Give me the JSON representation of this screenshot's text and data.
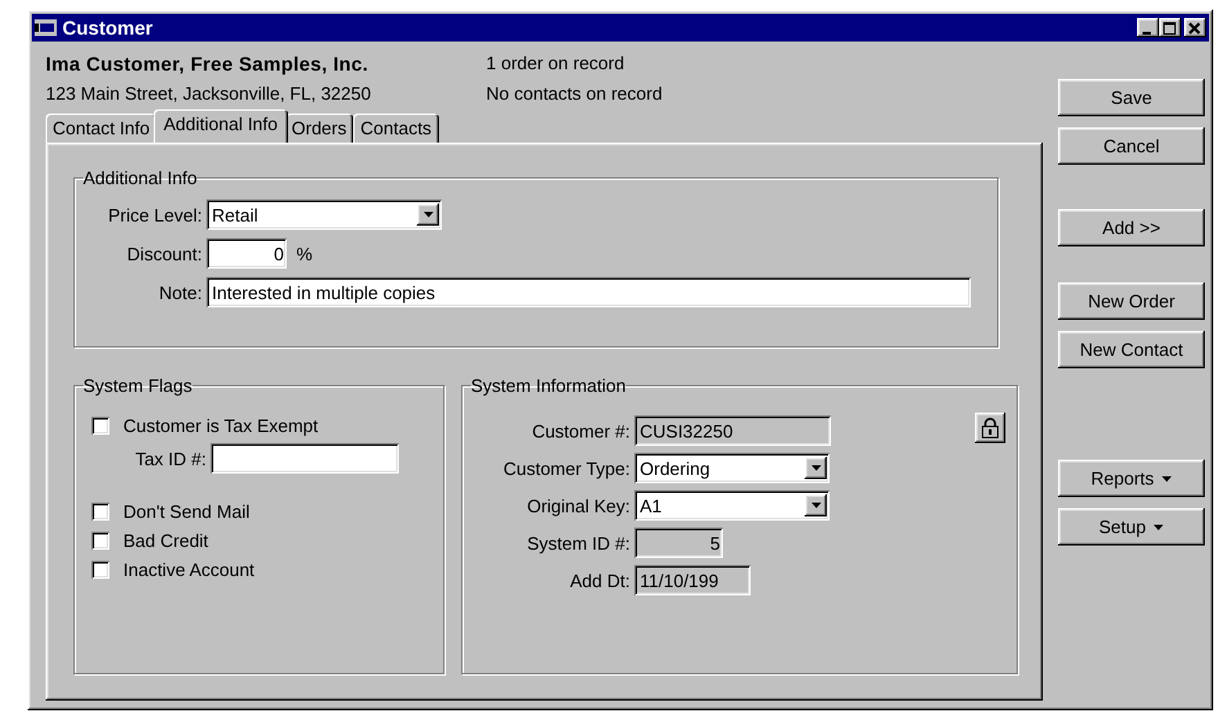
{
  "window": {
    "title": "Customer"
  },
  "header": {
    "name": "Ima Customer, Free Samples, Inc.",
    "address": "123 Main Street, Jacksonville, FL, 32250",
    "orders_summary": "1 order on record",
    "contacts_summary": "No contacts on record"
  },
  "tabs": [
    {
      "label": "Contact Info",
      "selected": false
    },
    {
      "label": "Additional Info",
      "selected": true
    },
    {
      "label": "Orders",
      "selected": false
    },
    {
      "label": "Contacts",
      "selected": false
    }
  ],
  "additional_info": {
    "title": "Additional Info",
    "fields": [
      {
        "kind": "dropdown",
        "label": "Price Level:",
        "value": "Retail"
      },
      {
        "kind": "number",
        "label": "Discount:",
        "value": "0",
        "suffix": "%"
      },
      {
        "kind": "text",
        "label": "Note:",
        "value": "Interested in multiple copies"
      }
    ]
  },
  "system_flags": {
    "title": "System Flags",
    "items": [
      {
        "kind": "checkbox",
        "label": "Customer is Tax Exempt",
        "checked": false
      },
      {
        "kind": "text",
        "label": "Tax ID #:"
      },
      {
        "kind": "checkbox",
        "label": "Don't Send Mail",
        "checked": false
      },
      {
        "kind": "checkbox",
        "label": "Bad Credit",
        "checked": false
      },
      {
        "kind": "checkbox",
        "label": "Inactive Account",
        "checked": false
      }
    ]
  },
  "system_information": {
    "title": "System Information",
    "fields": [
      {
        "kind": "readonly",
        "label": "Customer #:",
        "value": "CUSI32250"
      },
      {
        "kind": "dropdown",
        "label": "Customer Type:",
        "value": "Ordering"
      },
      {
        "kind": "dropdown",
        "label": "Original Key:",
        "value": "A1"
      },
      {
        "kind": "readonly_number",
        "label": "System ID #:",
        "value": "5"
      },
      {
        "kind": "readonly",
        "label": "Add Dt:",
        "value": "11/10/199"
      }
    ]
  },
  "buttons": [
    {
      "kind": "plain",
      "label": "Save"
    },
    {
      "kind": "plain",
      "label": "Cancel"
    },
    {
      "kind": "plain",
      "label": "Add >>"
    },
    {
      "kind": "plain",
      "label": "New Order"
    },
    {
      "kind": "plain",
      "label": "New Contact"
    },
    {
      "kind": "menu",
      "label": "Reports"
    },
    {
      "kind": "menu",
      "label": "Setup"
    }
  ]
}
